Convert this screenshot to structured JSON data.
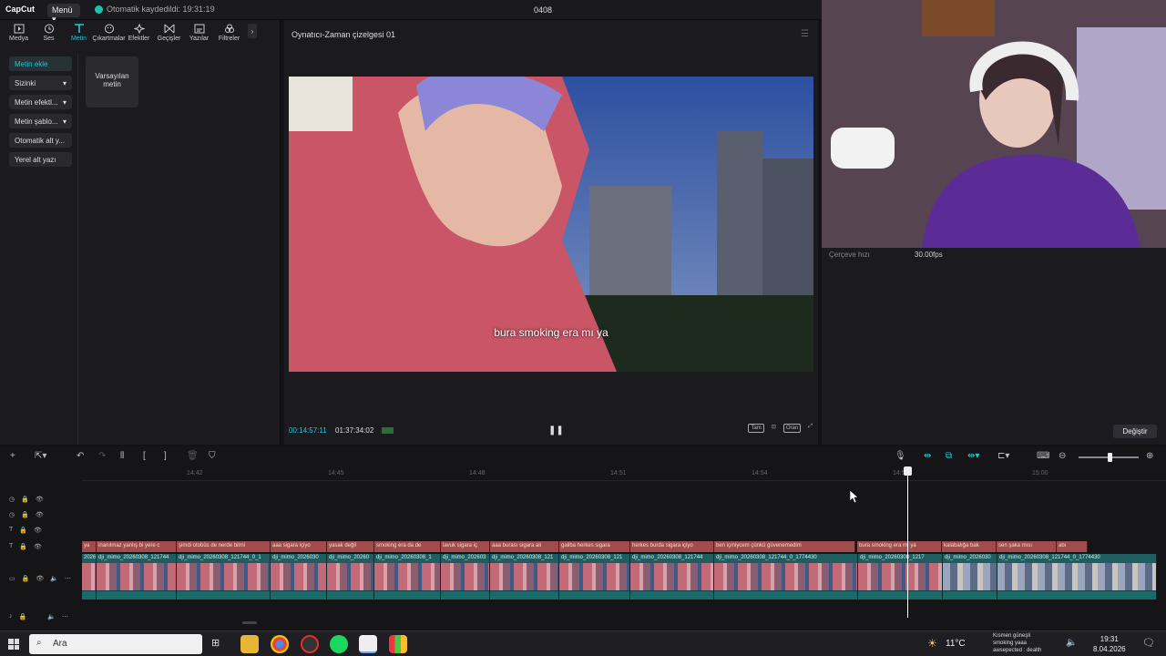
{
  "topbar": {
    "logo": "CapCut",
    "menu_label": "Menü",
    "save_status": "Otomatik kaydedildi: 19:31:19",
    "project_title": "0408"
  },
  "tools": [
    {
      "label": "Medya",
      "icon": "media-icon"
    },
    {
      "label": "Ses",
      "icon": "audio-icon"
    },
    {
      "label": "Metin",
      "icon": "text-icon",
      "active": true
    },
    {
      "label": "Çıkartmalar",
      "icon": "sticker-icon"
    },
    {
      "label": "Efektler",
      "icon": "effects-icon"
    },
    {
      "label": "Geçişler",
      "icon": "transitions-icon"
    },
    {
      "label": "Yazılar",
      "icon": "captions-icon"
    },
    {
      "label": "Filtreler",
      "icon": "filters-icon"
    }
  ],
  "sidebar": [
    {
      "label": "Metin ekle",
      "active": true
    },
    {
      "label": "Sizinki",
      "chevron": true
    },
    {
      "label": "Metin efektl...",
      "chevron": true
    },
    {
      "label": "Metin şablo...",
      "chevron": true
    },
    {
      "label": "Otomatik alt y..."
    },
    {
      "label": "Yerel alt yazı"
    }
  ],
  "text_card": "Varsayılan metin",
  "player": {
    "title": "Oynatıcı-Zaman çizelgesi 01",
    "subtitle": "bura smoking era mı ya",
    "current_time": "00:14:57:11",
    "total_time": "01:37:34:02",
    "full_label": "Tam",
    "ratio_label": "Oran"
  },
  "properties": {
    "label": "Çerçeve hızı",
    "value": "30.00fps",
    "button": "Değiştir"
  },
  "ruler_ticks": [
    "14:42",
    "14:45",
    "14:48",
    "14:51",
    "14:54",
    "14:57",
    "15:00"
  ],
  "text_clips": [
    "yа",
    "inanılmaz yanlış bi yere c",
    "şimdi otobüs de nerde bilmi",
    "aaa sigara içiyo",
    "yasak değil",
    "smoking era da de",
    "lavuk sigara iç",
    "aaa burası sigara alı",
    "galiba herkes sigara",
    "herkes burda sigara içiyo",
    "ben içmiycem çünkü güvenemedim",
    "bura smoking era mı ya",
    "kalabalığa bak",
    "sen şaka mısı",
    "abi"
  ],
  "video_clips": [
    "2026",
    "dji_mimo_20260308_121744",
    "dji_mimo_20260308_121744_0_1",
    "dji_mimo_2026030",
    "dji_mimo_20260",
    "dji_mimo_20260308_1",
    "dji_mimo_202603",
    "dji_mimo_20260308_121",
    "dji_mimo_20260308_121",
    "dji_mimo_20260308_121744",
    "dji_mimo_20260308_121744_0_1774430",
    "dji_mimo_20260308_1217",
    "dji_mimo_2026030",
    "dji_mimo_20260308_121744_0_1774430"
  ],
  "taskbar": {
    "search_placeholder": "Ara",
    "temperature": "11°C",
    "weather_text": "Kısmen güneşli",
    "notif_line1": "smoking yaaa",
    "notif_line2": "awsepected : dealth",
    "time": "19:31",
    "date": "8.04.2026"
  },
  "colors": {
    "accent": "#22c8d6",
    "text_clip": "#a04c4c",
    "video_clip": "#164b4e"
  }
}
